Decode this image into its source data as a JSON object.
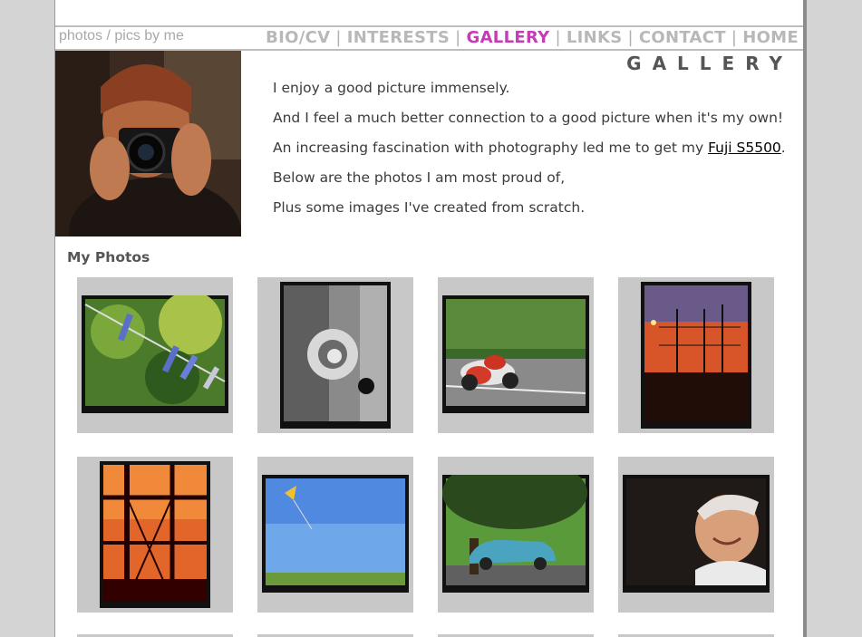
{
  "header": {
    "tagline": "photos / pics by me",
    "nav": [
      {
        "label": "BIO/CV",
        "active": false
      },
      {
        "label": "INTERESTS",
        "active": false
      },
      {
        "label": "GALLERY",
        "active": true
      },
      {
        "label": "LINKS",
        "active": false
      },
      {
        "label": "CONTACT",
        "active": false
      },
      {
        "label": "HOME",
        "active": false
      }
    ],
    "separator": "|",
    "active_color": "#c33cb8"
  },
  "section_title": "GALLERY",
  "intro": {
    "line1": "I enjoy a good picture immensely.",
    "line2": "And I feel a much better connection to a good picture when it's my own!",
    "line3_before": "An increasing fascination with photography led me to get my ",
    "line3_link": "Fuji S5500",
    "line3_after": ".",
    "line4": "Below are the photos I am most proud of,",
    "line5": "Plus some images I've created from scratch."
  },
  "photos_heading": "My Photos",
  "photos": [
    {
      "subject": "clothes pegs on a line"
    },
    {
      "subject": "black and white curled metal"
    },
    {
      "subject": "motorbike racer"
    },
    {
      "subject": "tall ship masts at sunset"
    },
    {
      "subject": "ship rigging at sunset"
    },
    {
      "subject": "kite in blue sky"
    },
    {
      "subject": "blue car under tree"
    },
    {
      "subject": "smiling man"
    }
  ]
}
